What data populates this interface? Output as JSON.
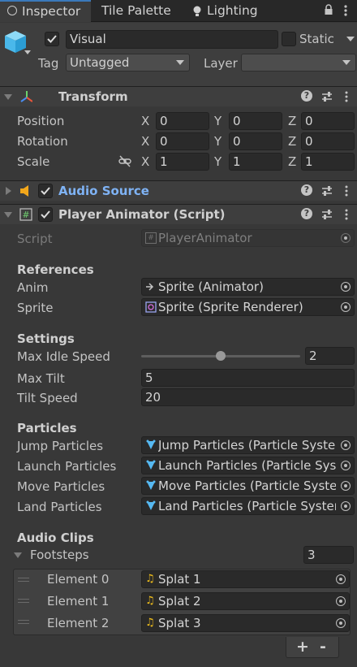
{
  "tabs": [
    {
      "label": "Inspector",
      "icon": "info-icon",
      "active": true
    },
    {
      "label": "Tile Palette",
      "active": false
    },
    {
      "label": "Lighting",
      "icon": "light-bulb-icon",
      "active": false
    }
  ],
  "object": {
    "name": "Visual",
    "active": true,
    "static_label": "Static",
    "static": false,
    "tag_label": "Tag",
    "tag_value": "Untagged",
    "layer_label": "Layer",
    "layer_value": ""
  },
  "transform": {
    "title": "Transform",
    "position_label": "Position",
    "rotation_label": "Rotation",
    "scale_label": "Scale",
    "axis_x": "X",
    "axis_y": "Y",
    "axis_z": "Z",
    "position": [
      "0",
      "0",
      "0"
    ],
    "rotation": [
      "0",
      "0",
      "0"
    ],
    "scale": [
      "1",
      "1",
      "1"
    ]
  },
  "audio_source": {
    "title": "Audio Source",
    "enabled": true
  },
  "player_animator": {
    "title": "Player Animator (Script)",
    "enabled": true,
    "script_label": "Script",
    "script_value": "PlayerAnimator",
    "references_header": "References",
    "anim_label": "Anim",
    "anim_value": "Sprite (Animator)",
    "sprite_label": "Sprite",
    "sprite_value": "Sprite (Sprite Renderer)",
    "settings_header": "Settings",
    "max_idle_speed_label": "Max Idle Speed",
    "max_idle_speed_value": "2",
    "max_idle_speed_fraction": 0.5,
    "max_tilt_label": "Max Tilt",
    "max_tilt_value": "5",
    "tilt_speed_label": "Tilt Speed",
    "tilt_speed_value": "20",
    "particles_header": "Particles",
    "jump_particles_label": "Jump Particles",
    "jump_particles_value": "Jump Particles (Particle Systen",
    "launch_particles_label": "Launch Particles",
    "launch_particles_value": "Launch Particles (Particle Syste",
    "move_particles_label": "Move Particles",
    "move_particles_value": "Move Particles (Particle Systen",
    "land_particles_label": "Land Particles",
    "land_particles_value": "Land Particles (Particle System",
    "audio_clips_header": "Audio Clips",
    "footsteps_label": "Footsteps",
    "footsteps_count": "3",
    "elements": [
      {
        "label": "Element 0",
        "value": "Splat 1"
      },
      {
        "label": "Element 1",
        "value": "Splat 2"
      },
      {
        "label": "Element 2",
        "value": "Splat 3"
      }
    ],
    "add_label": "+",
    "remove_label": "-"
  },
  "colors": {
    "accent": "#3a79bb",
    "link": "#7fb3f5",
    "panel": "#383838"
  }
}
